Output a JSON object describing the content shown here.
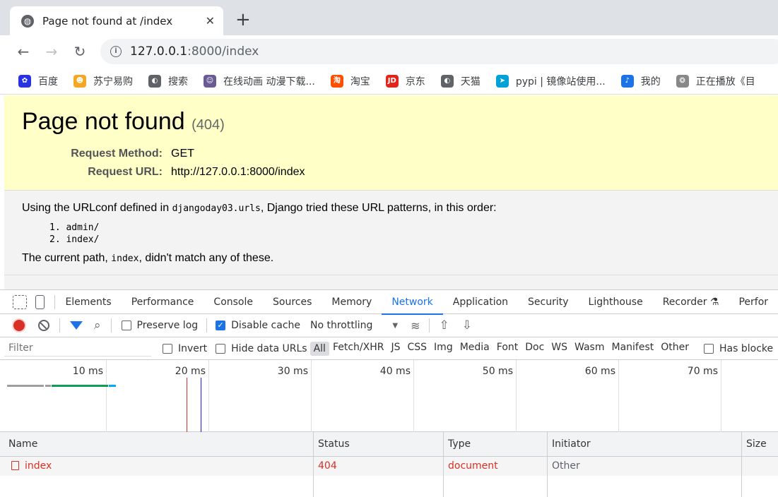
{
  "browser": {
    "tab_title": "Page not found at /index",
    "url_host": "127.0.0.1",
    "url_path": ":8000/index"
  },
  "bookmarks": [
    {
      "label": "百度",
      "color": "#2932e1",
      "glyph": "✿"
    },
    {
      "label": "苏宁易购",
      "color": "#f5a623",
      "glyph": "☻"
    },
    {
      "label": "搜索",
      "color": "#5f6368",
      "glyph": "◐"
    },
    {
      "label": "在线动画 动漫下载...",
      "color": "#6b5b95",
      "glyph": "☺"
    },
    {
      "label": "淘宝",
      "color": "#ff5000",
      "glyph": "淘"
    },
    {
      "label": "京东",
      "color": "#e1251b",
      "glyph": "JD"
    },
    {
      "label": "天猫",
      "color": "#5f6368",
      "glyph": "◐"
    },
    {
      "label": "pypi | 镜像站使用...",
      "color": "#00a1d6",
      "glyph": "➤"
    },
    {
      "label": "我的",
      "color": "#1a73e8",
      "glyph": "♪"
    },
    {
      "label": "正在播放《目",
      "color": "#888888",
      "glyph": "❂"
    }
  ],
  "page": {
    "heading": "Page not found",
    "code": "(404)",
    "request_method_label": "Request Method:",
    "request_method": "GET",
    "request_url_label": "Request URL:",
    "request_url": "http://127.0.0.1:8000/index",
    "urlconf_prefix": "Using the URLconf defined in ",
    "urlconf_name": "djangoday03.urls",
    "urlconf_suffix": ", Django tried these URL patterns, in this order:",
    "patterns": [
      "1.  admin/",
      "2.  index/"
    ],
    "current_prefix": "The current path, ",
    "current_path": "index",
    "current_suffix": ", didn't match any of these."
  },
  "devtools": {
    "tabs": [
      "Elements",
      "Performance",
      "Console",
      "Sources",
      "Memory",
      "Network",
      "Application",
      "Security",
      "Lighthouse",
      "Recorder ⚗",
      "Perfor"
    ],
    "active_tab": "Network",
    "preserve_log": "Preserve log",
    "disable_cache": "Disable cache",
    "throttling": "No throttling",
    "filter_placeholder": "Filter",
    "invert": "Invert",
    "hide_data_urls": "Hide data URLs",
    "types": [
      "All",
      "Fetch/XHR",
      "JS",
      "CSS",
      "Img",
      "Media",
      "Font",
      "Doc",
      "WS",
      "Wasm",
      "Manifest",
      "Other"
    ],
    "has_blocked": "Has blocke",
    "ticks": [
      "10 ms",
      "20 ms",
      "30 ms",
      "40 ms",
      "50 ms",
      "60 ms",
      "70 ms"
    ],
    "columns": [
      "Name",
      "Status",
      "Type",
      "Initiator",
      "Size"
    ],
    "rows": [
      {
        "name": "index",
        "status": "404",
        "type": "document",
        "initiator": "Other"
      }
    ]
  }
}
